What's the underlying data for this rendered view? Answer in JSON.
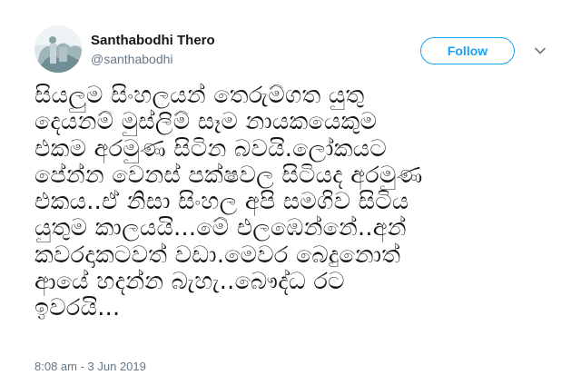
{
  "author": {
    "display_name": "Santhabodhi Thero",
    "handle": "@santhabodhi",
    "avatar_icon": "profile-avatar"
  },
  "actions": {
    "follow_label": "Follow",
    "more_icon": "chevron-down-icon"
  },
  "tweet": {
    "text": "සියලුම සිංහලයන් තෙරුම්ගත යුතු\nදෙයනම් මුස්ලිම් සෑම නායකයෙකුම\nඑකම අරමුණ සිටින බවයි.ලෝකයට\nපේන්න වෙනස් පක්ෂවල සිටියද අරමුණ\nඑකය..ඒ නිසා සිංහල අපි සමගිව සිටිය\nයුතුම කාලයයි...මේ එලඹෙන්නේ..අන්\nකවරදාකටවත් වඩා.මෙවර බෙදුනොත්\nආයේ හදන්න බැහැ..බෞද්ධ රට\nඉවරයි...",
    "timestamp": "8:08 am - 3 Jun 2019"
  },
  "colors": {
    "accent": "#1da1f2",
    "text": "#14171a",
    "muted": "#657786"
  }
}
